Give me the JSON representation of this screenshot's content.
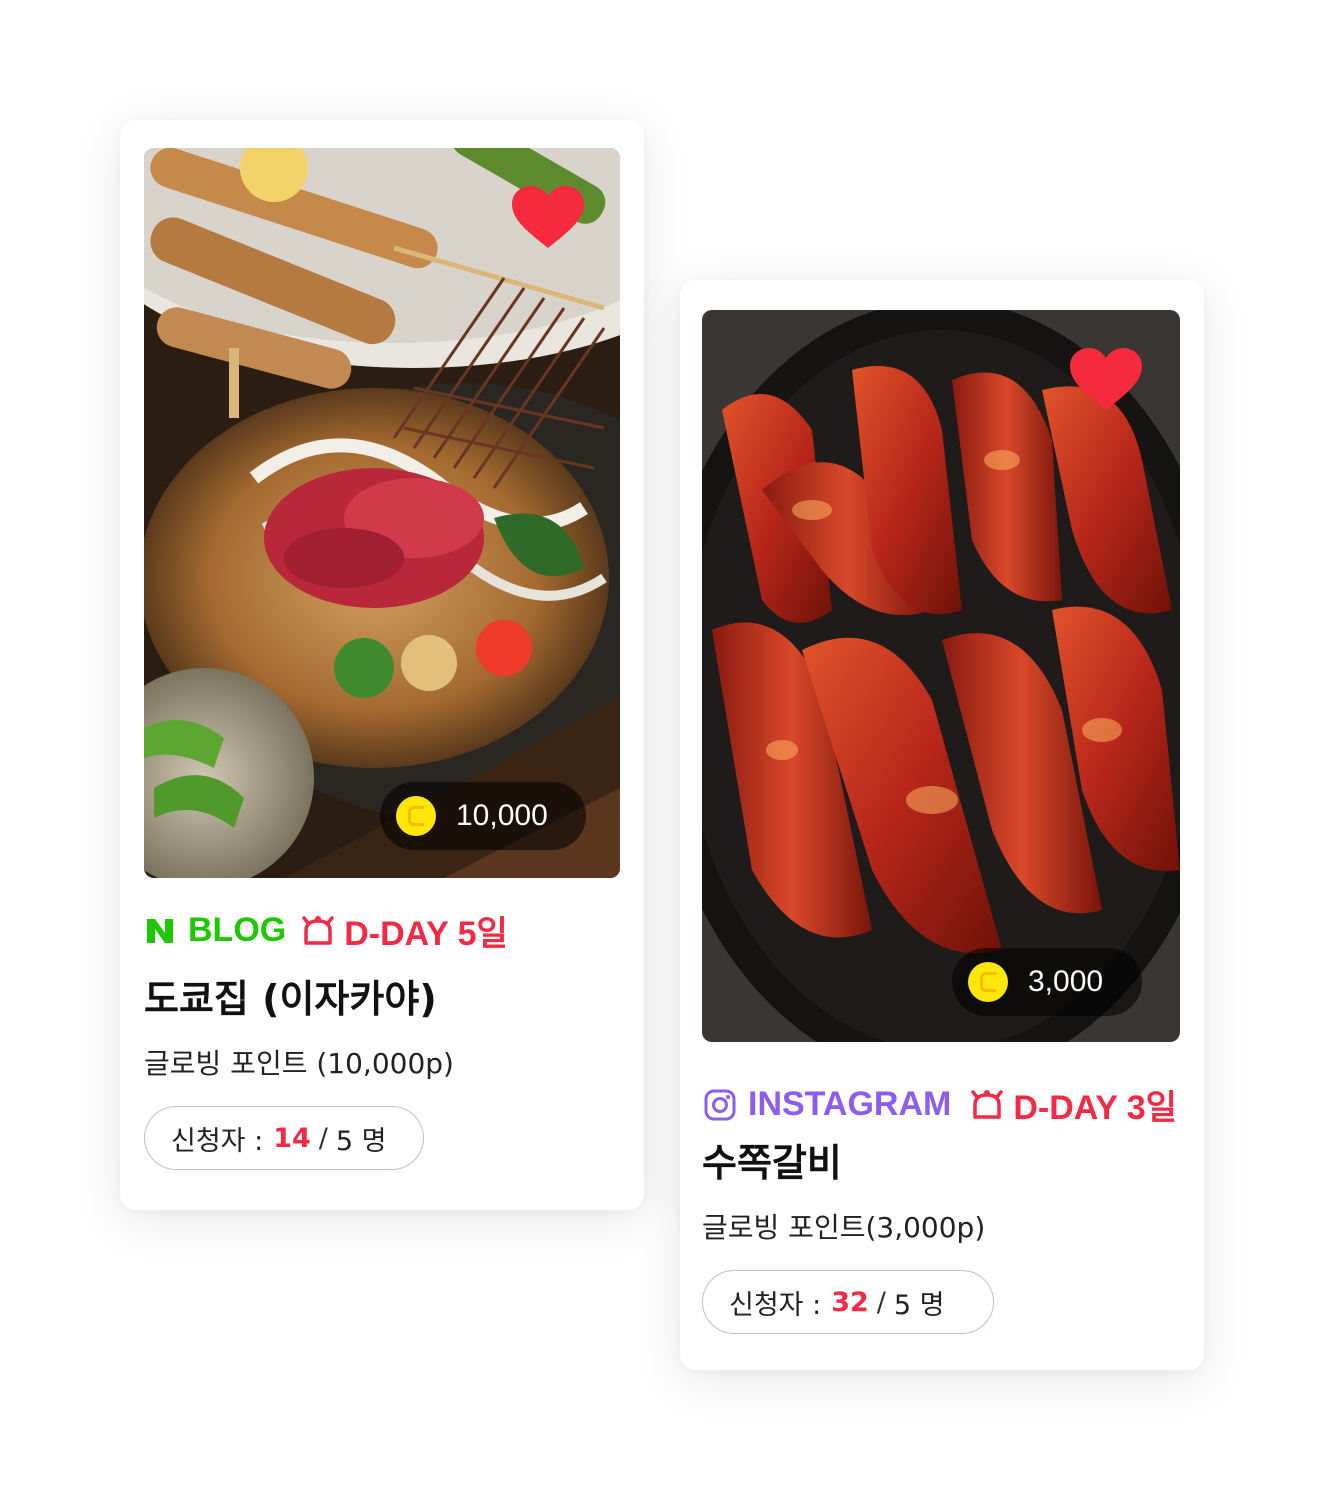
{
  "cards": [
    {
      "platform": "BLOG",
      "platform_icon": "naver-n-icon",
      "platform_color": "#1ec800",
      "dday": "D-DAY 5일",
      "title": "도쿄집 (이자카야)",
      "reward": "글로빙 포인트 (10,000p)",
      "points": "10,000",
      "applicants_label": "신청자 :",
      "applicants_count": "14",
      "applicants_capacity": "5 명",
      "favorited": true
    },
    {
      "platform": "INSTAGRAM",
      "platform_icon": "instagram-icon",
      "platform_color": "#8c5cf5",
      "dday": "D-DAY 3일",
      "title": "수쪽갈비",
      "reward": "글로빙 포인트(3,000p)",
      "points": "3,000",
      "applicants_label": "신청자 :",
      "applicants_count": "32",
      "applicants_capacity": "5 명",
      "favorited": true
    }
  ],
  "colors": {
    "accent_red": "#f42a44",
    "heart": "#f52a3d",
    "coin": "#ffe60a",
    "pill_border": "#b8c4d6"
  },
  "separator": "/"
}
